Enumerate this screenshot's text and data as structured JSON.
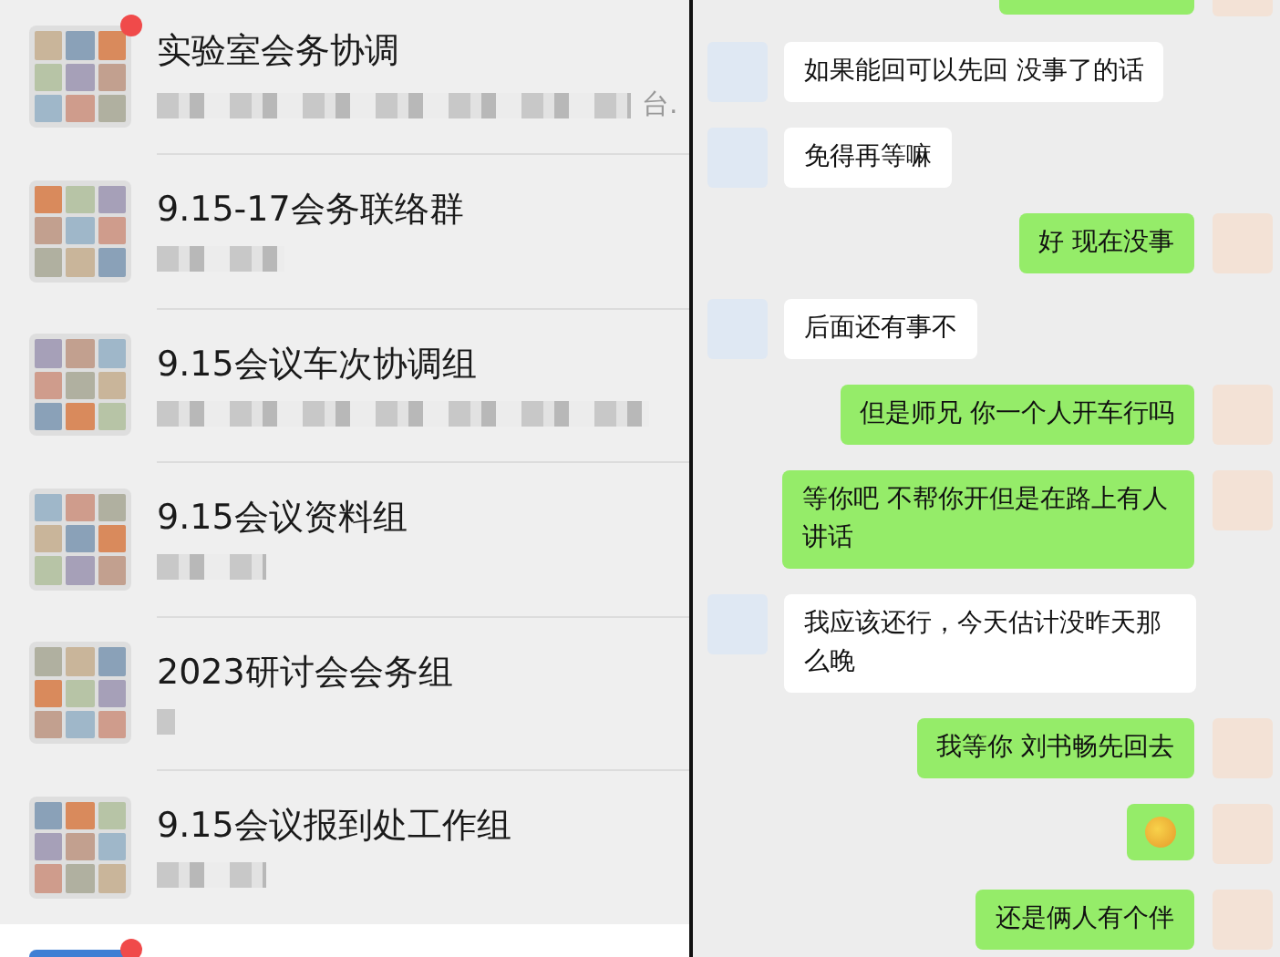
{
  "chat_list": {
    "items": [
      {
        "title": "实验室会务协调",
        "preview": "台.",
        "unread": true,
        "selected": false
      },
      {
        "title": "9.15-17会务联络群",
        "unread": false,
        "selected": false
      },
      {
        "title": "9.15会议车次协调组",
        "unread": false,
        "selected": false
      },
      {
        "title": "9.15会议资料组",
        "unread": false,
        "selected": false
      },
      {
        "title": "2023研讨会会务组",
        "unread": false,
        "selected": false
      },
      {
        "title": "9.15会议报到处工作组",
        "unread": false,
        "selected": false
      },
      {
        "unread": true,
        "selected": true
      }
    ]
  },
  "conversation": {
    "messages": [
      {
        "kind": "out"
      },
      {
        "kind": "in",
        "text": "如果能回可以先回  没事了的话"
      },
      {
        "kind": "in",
        "text": "免得再等嘛"
      },
      {
        "kind": "out",
        "text": "好 现在没事"
      },
      {
        "kind": "in",
        "text": "后面还有事不"
      },
      {
        "kind": "out",
        "text": "但是师兄 你一个人开车行吗"
      },
      {
        "kind": "out",
        "text": "等你吧 不帮你开但是在路上有人讲话"
      },
      {
        "kind": "in",
        "text": "我应该还行，今天估计没昨天那么晚"
      },
      {
        "kind": "out",
        "text": "我等你 刘书畅先回去"
      },
      {
        "kind": "out_emoji"
      },
      {
        "kind": "out",
        "text": "还是俩人有个伴"
      }
    ]
  }
}
